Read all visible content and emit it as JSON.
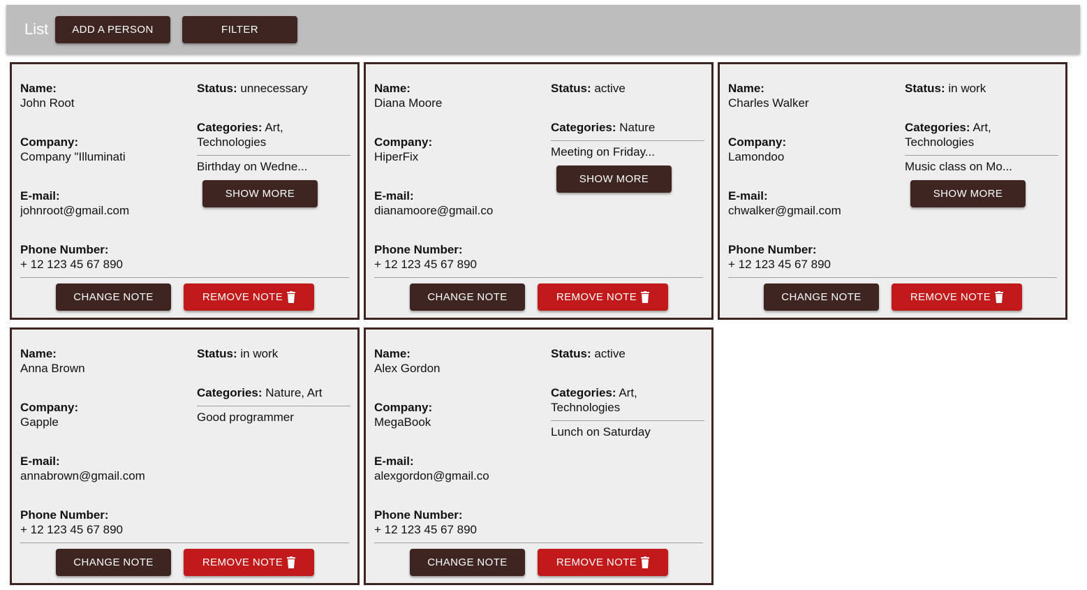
{
  "header": {
    "title": "List",
    "add_label": "ADD A PERSON",
    "filter_label": "FILTER"
  },
  "labels": {
    "name": "Name:",
    "company": "Company:",
    "email": "E-mail:",
    "phone": "Phone Number:",
    "status": "Status:",
    "categories": "Categories:",
    "show_more": "SHOW MORE",
    "change_note": "CHANGE NOTE",
    "remove_note": "REMOVE NOTE"
  },
  "colors": {
    "primary": "#3e2522",
    "danger": "#c21a1a",
    "card_bg": "#eeeeee",
    "header_bg": "#bdbdbd"
  },
  "cards": [
    {
      "name": "John Root",
      "company": "Company \"Illuminati",
      "email": "johnroot@gmail.com",
      "phone": "+ 12 123 45 67 890",
      "status": "unnecessary",
      "categories": "Art, Technologies",
      "note": "Birthday on Wedne...",
      "show_more": true
    },
    {
      "name": "Diana Moore",
      "company": "HiperFix",
      "email": "dianamoore@gmail.co",
      "phone": "+ 12 123 45 67 890",
      "status": "active",
      "categories": "Nature",
      "note": "Meeting on Friday...",
      "show_more": true
    },
    {
      "name": "Charles Walker",
      "company": "Lamondoo",
      "email": "chwalker@gmail.com",
      "phone": "+ 12 123 45 67 890",
      "status": "in work",
      "categories": "Art, Technologies",
      "note": "Music class on Mo...",
      "show_more": true
    },
    {
      "name": "Anna Brown",
      "company": "Gapple",
      "email": "annabrown@gmail.com",
      "phone": "+ 12 123 45 67 890",
      "status": "in work",
      "categories": "Nature, Art",
      "note": "Good programmer",
      "show_more": false
    },
    {
      "name": "Alex Gordon",
      "company": "MegaBook",
      "email": "alexgordon@gmail.co",
      "phone": "+ 12 123 45 67 890",
      "status": "active",
      "categories": "Art, Technologies",
      "note": "Lunch on Saturday",
      "show_more": false
    }
  ]
}
